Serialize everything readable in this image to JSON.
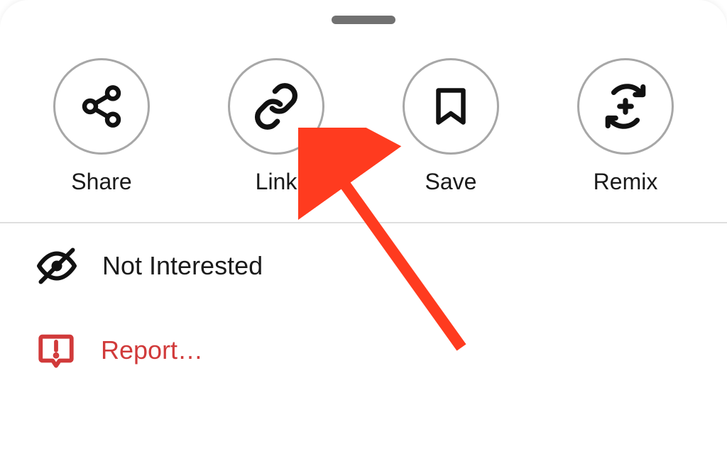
{
  "actions": {
    "share": {
      "label": "Share",
      "icon": "share-icon"
    },
    "link": {
      "label": "Link",
      "icon": "link-icon"
    },
    "save": {
      "label": "Save",
      "icon": "bookmark-icon"
    },
    "remix": {
      "label": "Remix",
      "icon": "remix-icon"
    }
  },
  "menu": {
    "not_interested": {
      "label": "Not Interested",
      "icon": "eye-off-icon"
    },
    "report": {
      "label": "Report…",
      "icon": "report-icon",
      "danger": true
    }
  }
}
